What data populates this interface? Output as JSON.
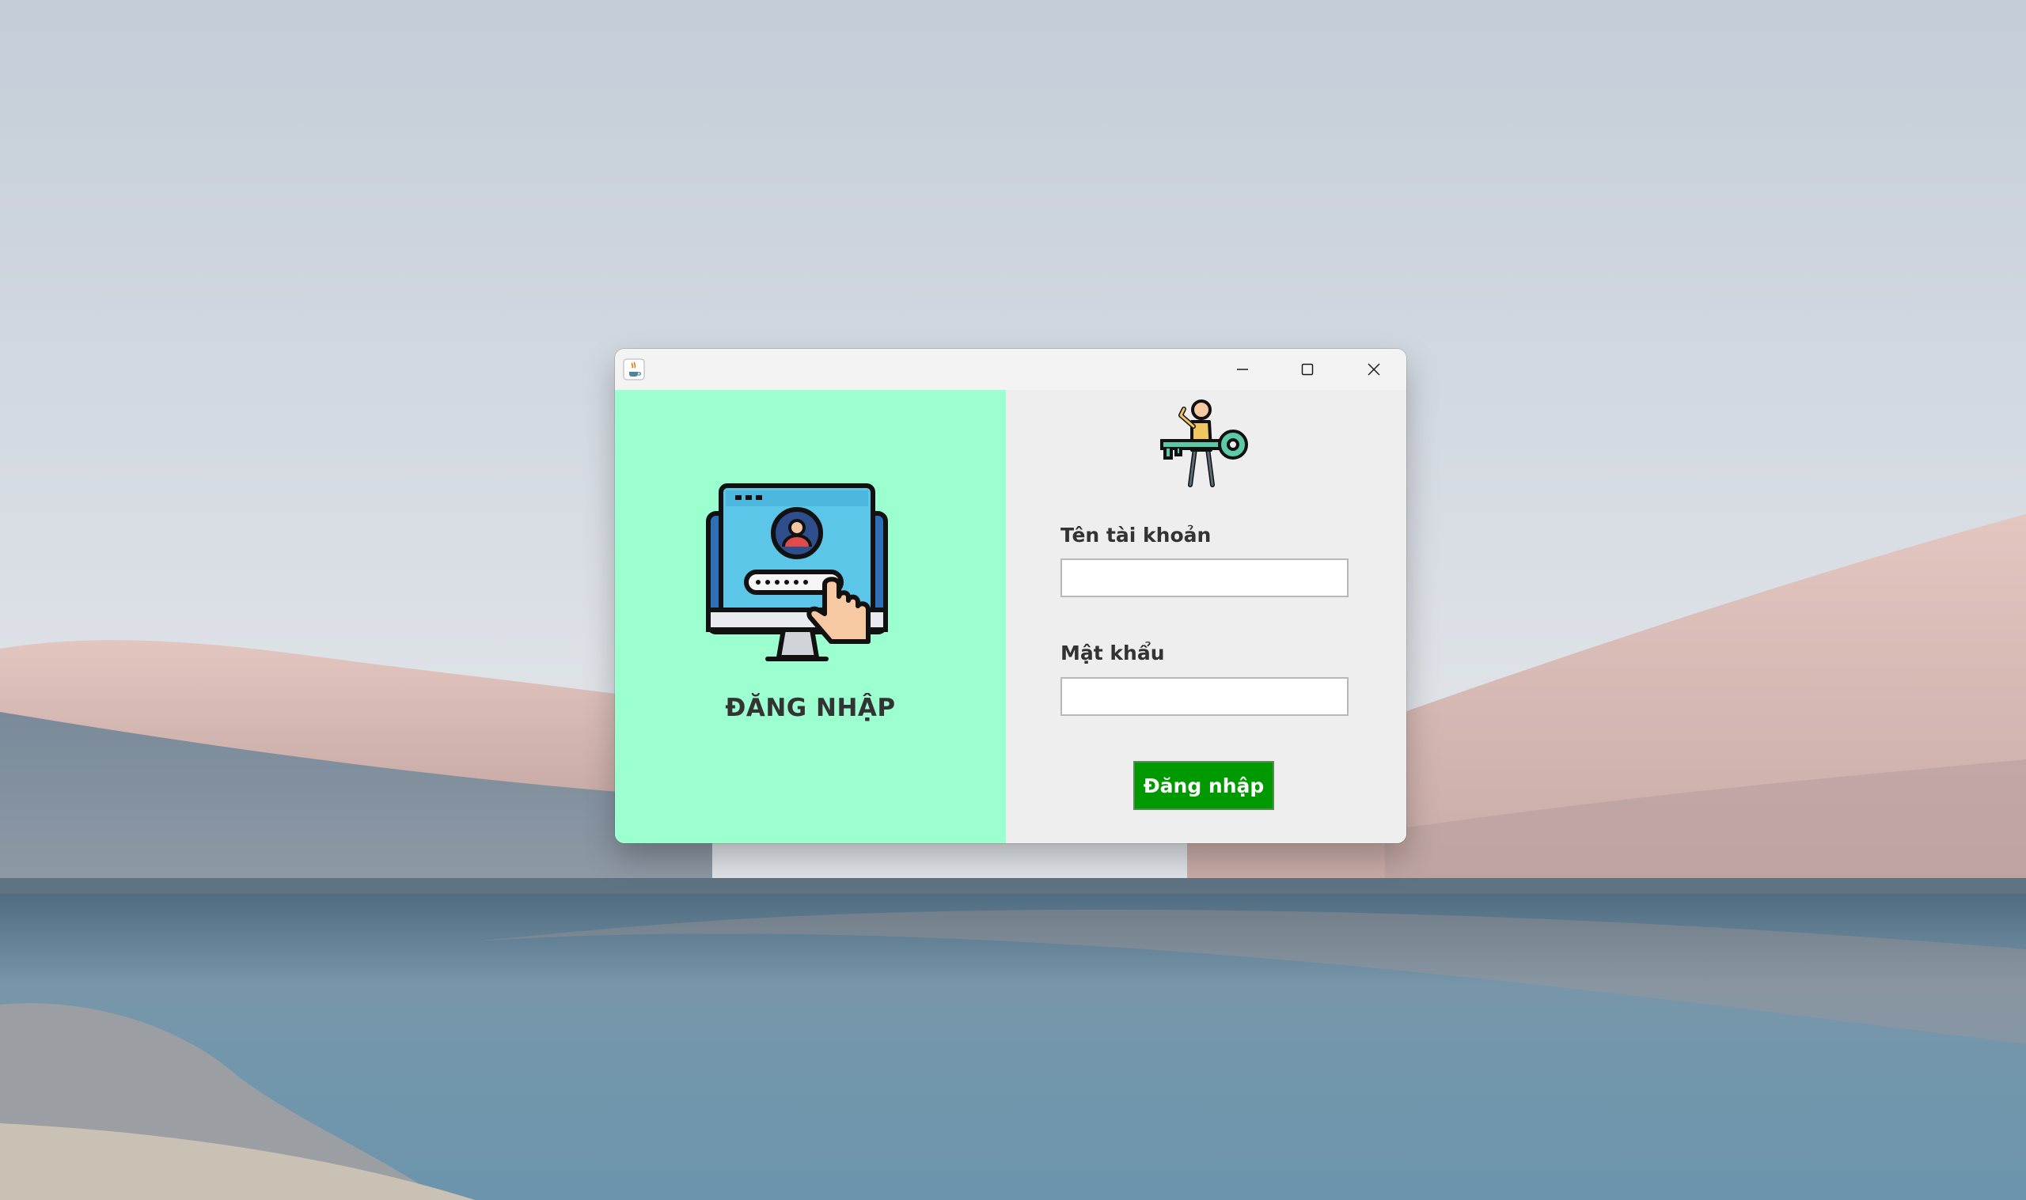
{
  "desktop": {
    "wallpaper": "desert-dunes-lake"
  },
  "window": {
    "app_icon": "java-coffee-icon",
    "controls": {
      "minimize": "minimize-icon",
      "maximize": "maximize-icon",
      "close": "close-icon"
    }
  },
  "left_panel": {
    "title": "ĐĂNG NHẬP",
    "illustration": "monitor-login-icon",
    "background_color": "#9cffd0"
  },
  "right_panel": {
    "illustration": "person-key-icon",
    "username": {
      "label": "Tên tài khoản",
      "value": ""
    },
    "password": {
      "label": "Mật khẩu",
      "value": ""
    },
    "submit_label": "Đăng nhập",
    "submit_color": "#009900"
  }
}
